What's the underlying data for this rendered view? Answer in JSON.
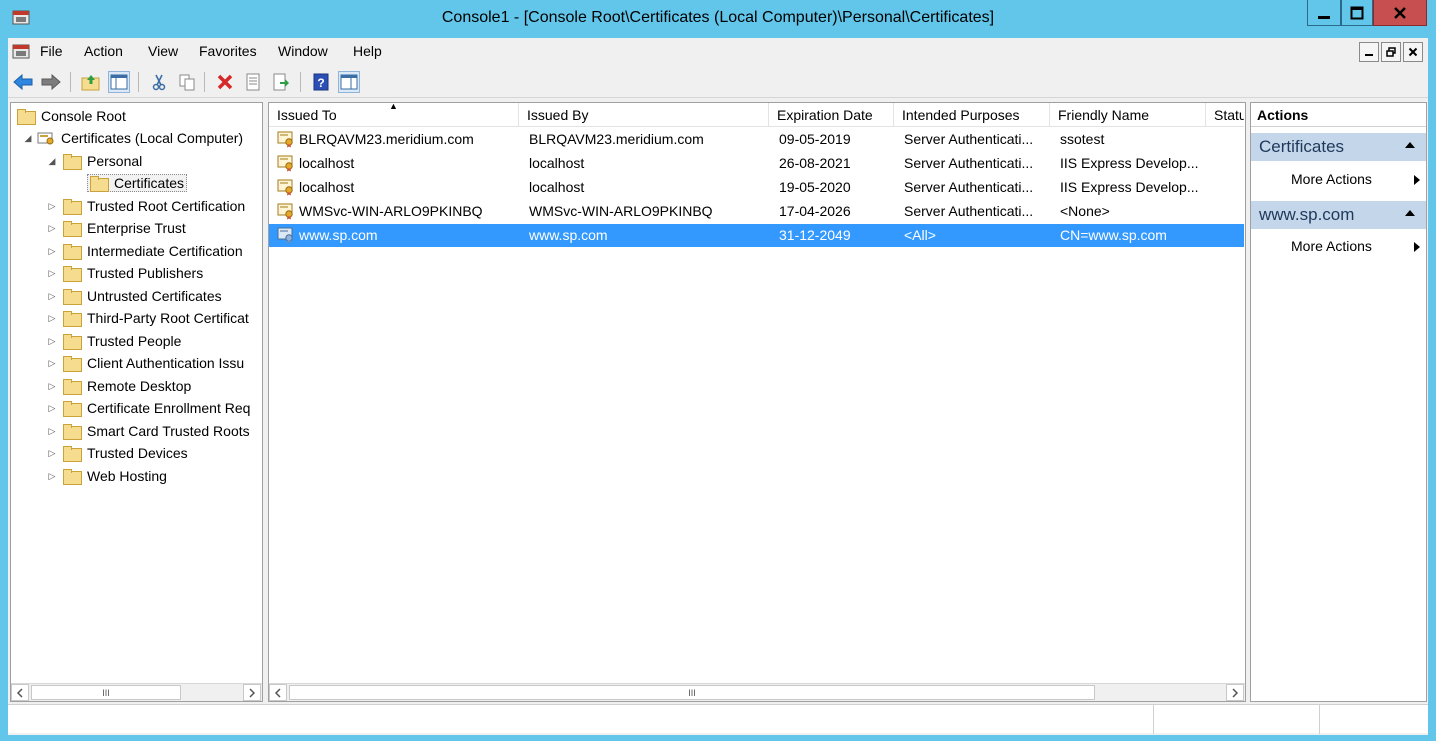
{
  "window": {
    "title": "Console1 - [Console Root\\Certificates (Local Computer)\\Personal\\Certificates]",
    "minimize_glyph": "–",
    "maximize_glyph": "□",
    "close_glyph": "✕"
  },
  "menubar": {
    "items": [
      "File",
      "Action",
      "View",
      "Favorites",
      "Window",
      "Help"
    ],
    "mdi": {
      "minimize": "_",
      "restore": "❐",
      "close": "x"
    }
  },
  "toolbar": {
    "buttons": [
      "back-icon",
      "forward-icon",
      "up-folder-icon",
      "show-hide-tree-icon",
      "cut-icon",
      "copy-icon",
      "delete-icon",
      "properties-icon",
      "export-icon",
      "help-icon",
      "show-hide-action-pane-icon"
    ]
  },
  "tree": {
    "root": "Console Root",
    "computer": "Certificates (Local Computer)",
    "personal": "Personal",
    "certificates": "Certificates",
    "stores": [
      "Trusted Root Certification",
      "Enterprise Trust",
      "Intermediate Certification",
      "Trusted Publishers",
      "Untrusted Certificates",
      "Third-Party Root Certificat",
      "Trusted People",
      "Client Authentication Issu",
      "Remote Desktop",
      "Certificate Enrollment Req",
      "Smart Card Trusted Roots",
      "Trusted Devices",
      "Web Hosting"
    ],
    "scrollbar_thumb": "III"
  },
  "list": {
    "columns": [
      "Issued To",
      "Issued By",
      "Expiration Date",
      "Intended Purposes",
      "Friendly Name",
      "Statu"
    ],
    "sort_indicator": "▲",
    "rows": [
      {
        "issued_to": "BLRQAVM23.meridium.com",
        "issued_by": "BLRQAVM23.meridium.com",
        "expiration": "09-05-2019",
        "purposes": "Server Authenticati...",
        "friendly": "ssotest",
        "status": ""
      },
      {
        "issued_to": "localhost",
        "issued_by": "localhost",
        "expiration": "26-08-2021",
        "purposes": "Server Authenticati...",
        "friendly": "IIS Express Develop...",
        "status": ""
      },
      {
        "issued_to": "localhost",
        "issued_by": "localhost",
        "expiration": "19-05-2020",
        "purposes": "Server Authenticati...",
        "friendly": "IIS Express Develop...",
        "status": ""
      },
      {
        "issued_to": "WMSvc-WIN-ARLO9PKINBQ",
        "issued_by": "WMSvc-WIN-ARLO9PKINBQ",
        "expiration": "17-04-2026",
        "purposes": "Server Authenticati...",
        "friendly": "<None>",
        "status": ""
      },
      {
        "issued_to": "www.sp.com",
        "issued_by": "www.sp.com",
        "expiration": "31-12-2049",
        "purposes": "<All>",
        "friendly": "CN=www.sp.com",
        "status": ""
      }
    ],
    "selected_row": 4,
    "scrollbar_thumb": "III"
  },
  "actions": {
    "title": "Actions",
    "groups": [
      {
        "label": "Certificates",
        "item": "More Actions"
      },
      {
        "label": "www.sp.com",
        "item": "More Actions"
      }
    ]
  },
  "colors": {
    "selection": "#3399ff",
    "action_group_bg": "#c4d6ea",
    "title_bar": "#62c6ea",
    "close_button": "#c74f4f"
  }
}
